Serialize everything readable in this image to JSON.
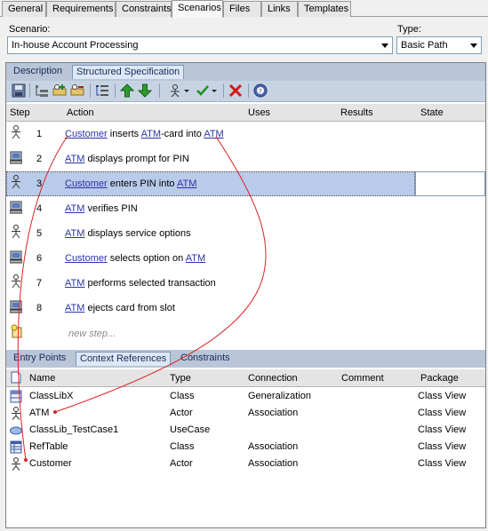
{
  "top_tabs": [
    "General",
    "Requirements",
    "Constraints",
    "Scenarios",
    "Files",
    "Links",
    "Templates"
  ],
  "active_top_tab": "Scenarios",
  "scenario": {
    "label": "Scenario:",
    "value": "In-house Account Processing",
    "type_label": "Type:",
    "type_value": "Basic Path"
  },
  "spec_tabs": [
    "Description",
    "Structured Specification"
  ],
  "active_spec_tab": "Structured Specification",
  "toolbar_icons": [
    "save-icon",
    "indent-icon",
    "add-actor-icon",
    "add-system-icon",
    "numbered-list-icon",
    "move-up-icon",
    "move-down-icon",
    "generate-icon",
    "validate-icon",
    "delete-icon",
    "help-icon"
  ],
  "steps_table": {
    "columns": [
      "Step",
      "Action",
      "Uses",
      "Results",
      "State"
    ],
    "rows": [
      {
        "num": "1",
        "actor": "actor",
        "parts": [
          {
            "t": "Customer",
            "link": true
          },
          {
            "t": " inserts ",
            "link": false
          },
          {
            "t": "ATM",
            "link": true
          },
          {
            "t": "-card into ",
            "link": false
          },
          {
            "t": "ATM",
            "link": true
          }
        ]
      },
      {
        "num": "2",
        "actor": "system",
        "parts": [
          {
            "t": "ATM",
            "link": true
          },
          {
            "t": " displays prompt for PIN",
            "link": false
          }
        ]
      },
      {
        "num": "3",
        "actor": "actor",
        "selected": true,
        "parts": [
          {
            "t": "Customer",
            "link": true
          },
          {
            "t": " enters PIN into ",
            "link": false
          },
          {
            "t": "ATM",
            "link": true
          }
        ]
      },
      {
        "num": "4",
        "actor": "system",
        "parts": [
          {
            "t": "ATM",
            "link": true
          },
          {
            "t": " verifies PIN",
            "link": false
          }
        ]
      },
      {
        "num": "5",
        "actor": "actor",
        "parts": [
          {
            "t": "ATM",
            "link": true
          },
          {
            "t": " displays service options",
            "link": false
          }
        ]
      },
      {
        "num": "6",
        "actor": "system",
        "parts": [
          {
            "t": "Customer",
            "link": true
          },
          {
            "t": " selects option on ",
            "link": false
          },
          {
            "t": "ATM",
            "link": true
          }
        ]
      },
      {
        "num": "7",
        "actor": "actor",
        "parts": [
          {
            "t": "ATM",
            "link": true
          },
          {
            "t": " performs selected transaction",
            "link": false
          }
        ]
      },
      {
        "num": "8",
        "actor": "system",
        "parts": [
          {
            "t": "ATM",
            "link": true
          },
          {
            "t": " ejects card from slot",
            "link": false
          }
        ]
      }
    ],
    "new_step_placeholder": "new step..."
  },
  "ref_tabs": [
    "Entry Points",
    "Context References",
    "Constraints"
  ],
  "active_ref_tab": "Context References",
  "refs_table": {
    "columns": [
      "Name",
      "Type",
      "Connection",
      "Comment",
      "Package"
    ],
    "rows": [
      {
        "name": "ClassLibX",
        "type": "Class",
        "connection": "Generalization",
        "comment": "",
        "package": "Class View",
        "icon": "class"
      },
      {
        "name": "ATM",
        "type": "Actor",
        "connection": "Association",
        "comment": "",
        "package": "Class View",
        "icon": "actor"
      },
      {
        "name": "ClassLib_TestCase1",
        "type": "UseCase",
        "connection": "",
        "comment": "",
        "package": "Class View",
        "icon": "usecase"
      },
      {
        "name": "RefTable",
        "type": "Class",
        "connection": "Association",
        "comment": "",
        "package": "Class View",
        "icon": "table"
      },
      {
        "name": "Customer",
        "type": "Actor",
        "connection": "Association",
        "comment": "",
        "package": "Class View",
        "icon": "actor"
      }
    ]
  },
  "colors": {
    "link": "#2a32a8",
    "selection": "#b9cbea",
    "annotation_line": "#e02020"
  }
}
